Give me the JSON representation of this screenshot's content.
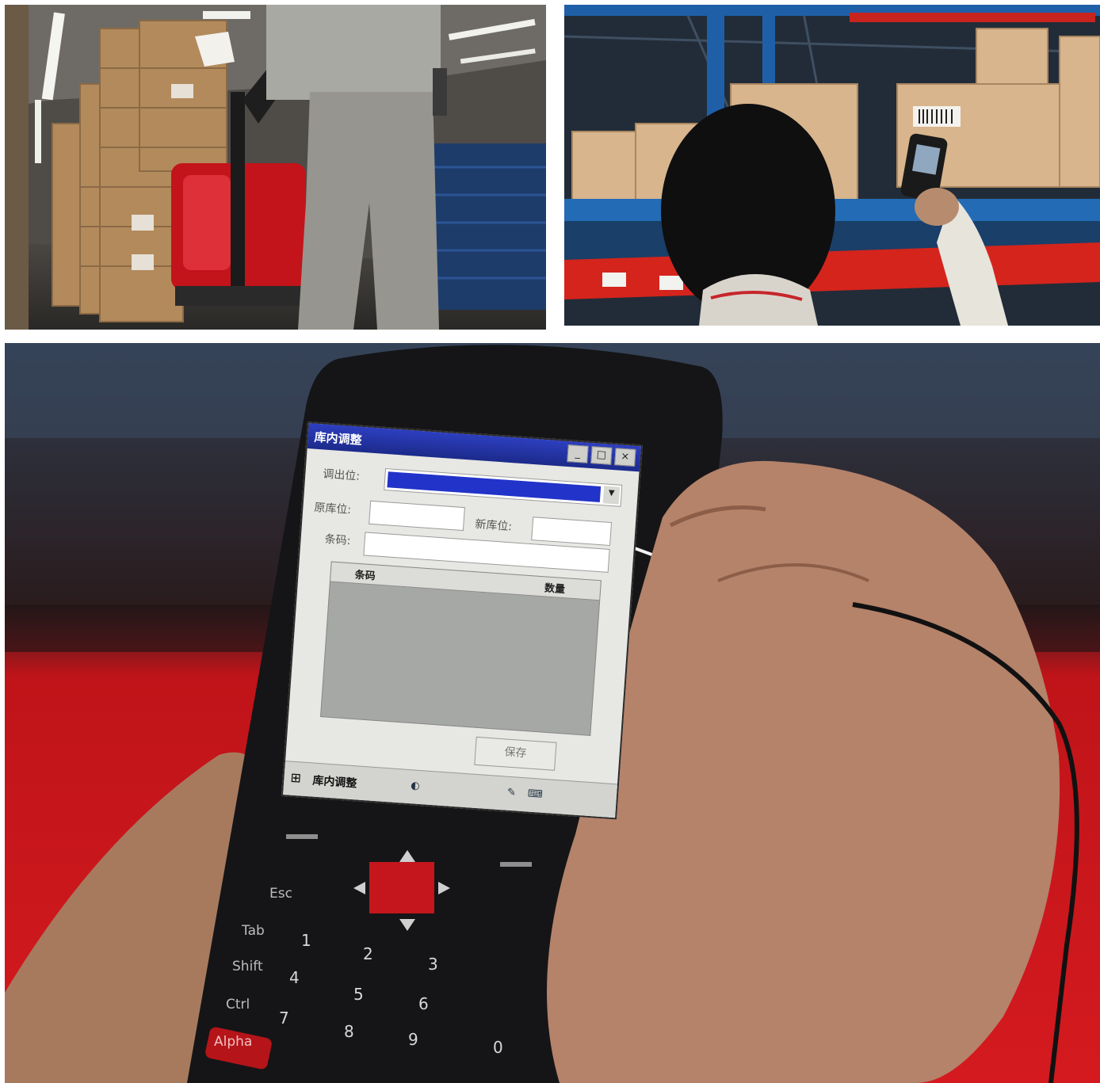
{
  "images": [
    {
      "name": "warehouse-pallet-truck",
      "palette": {
        "boxes": "#b88a5f",
        "truck": "#c3141b",
        "crates": "#1e3f6d",
        "uniform": "#9a9a95"
      }
    },
    {
      "name": "worker-scanning-shelf",
      "palette": {
        "rack_blue": "#1f5fa8",
        "rack_red": "#d4241c",
        "boxes": "#d7b48c",
        "hair": "#101010"
      }
    },
    {
      "name": "handheld-terminal-closeup",
      "palette": {
        "device": "#151517",
        "background_red": "#c9161b",
        "hand": "#b07e62"
      },
      "screen": {
        "title": "库内调整",
        "from_label": "调出位:",
        "orig_label": "原库位:",
        "new_label": "新库位:",
        "barcode_label": "条码:",
        "grid_col_code": "条码",
        "grid_col_qty": "数量",
        "save_label": "保存",
        "taskbar_app": "库内调整",
        "win_btn_min": "_",
        "win_btn_max": "□",
        "win_btn_close": "×",
        "taskbar_start": "⊞"
      },
      "keypad": {
        "esc": "Esc",
        "tab": "Tab",
        "shift": "Shift",
        "ctrl": "Ctrl",
        "alpha": "Alpha",
        "num_1": "1",
        "num_2": "2",
        "num_3": "3",
        "num_4": "4",
        "num_5": "5",
        "num_6": "6",
        "num_7": "7",
        "num_8": "8",
        "num_9": "9",
        "num_0": "0"
      }
    }
  ]
}
